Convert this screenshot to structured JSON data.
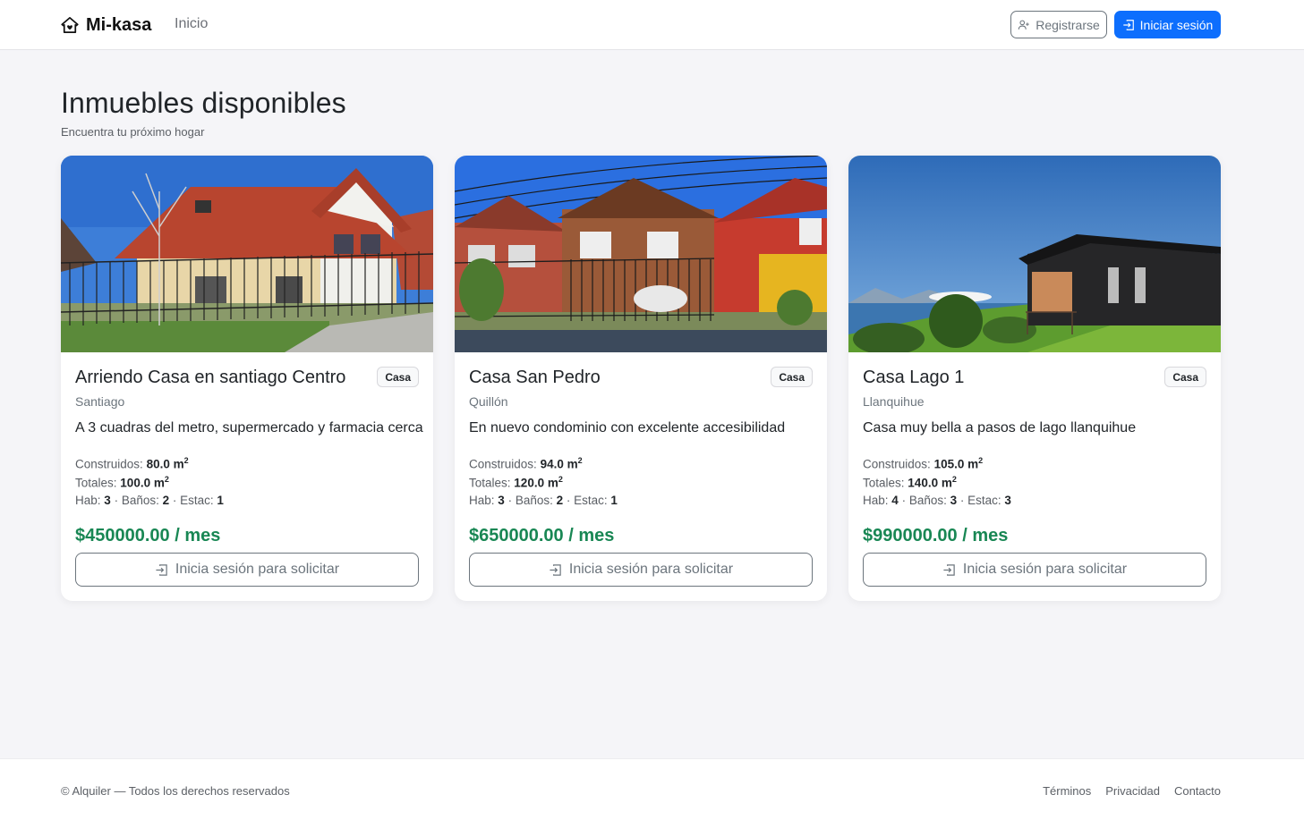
{
  "navbar": {
    "brand": "Mi-kasa",
    "brand_icon": "house-heart-icon",
    "links": [
      "Inicio"
    ],
    "register_label": "Registrarse",
    "register_icon": "person-plus-icon",
    "login_label": "Iniciar sesión",
    "login_icon": "box-arrow-in-right-icon",
    "accent_color": "#0d6efd"
  },
  "header": {
    "title": "Inmuebles disponibles",
    "subtitle": "Encuentra tu próximo hogar"
  },
  "listings": [
    {
      "title": "Arriendo Casa en santiago Centro",
      "type": "Casa",
      "city": "Santiago",
      "description": "A 3 cuadras del metro, supermercado y farmacia cerca",
      "built_label": "Construidos:",
      "built_value": "80.0 m",
      "total_label": "Totales:",
      "total_value": "100.0 m",
      "unit_sup": "2",
      "rooms_label": "Hab:",
      "rooms": "3",
      "baths_label": "Baños:",
      "baths": "2",
      "parking_label": "Estac:",
      "parking": "1",
      "price": "$450000.00 / mes",
      "action": "Inicia sesión para solicitar"
    },
    {
      "title": "Casa San Pedro",
      "type": "Casa",
      "city": "Quillón",
      "description": "En nuevo condominio con excelente accesibilidad",
      "built_label": "Construidos:",
      "built_value": "94.0 m",
      "total_label": "Totales:",
      "total_value": "120.0 m",
      "unit_sup": "2",
      "rooms_label": "Hab:",
      "rooms": "3",
      "baths_label": "Baños:",
      "baths": "2",
      "parking_label": "Estac:",
      "parking": "1",
      "price": "$650000.00 / mes",
      "action": "Inicia sesión para solicitar"
    },
    {
      "title": "Casa Lago 1",
      "type": "Casa",
      "city": "Llanquihue",
      "description": "Casa muy bella a pasos de lago llanquihue",
      "built_label": "Construidos:",
      "built_value": "105.0 m",
      "total_label": "Totales:",
      "total_value": "140.0 m",
      "unit_sup": "2",
      "rooms_label": "Hab:",
      "rooms": "4",
      "baths_label": "Baños:",
      "baths": "3",
      "parking_label": "Estac:",
      "parking": "3",
      "price": "$990000.00 / mes",
      "action": "Inicia sesión para solicitar"
    }
  ],
  "price_color": "#198754",
  "footer": {
    "copyright": "© Alquiler — Todos los derechos reservados",
    "links": [
      "Términos",
      "Privacidad",
      "Contacto"
    ]
  }
}
